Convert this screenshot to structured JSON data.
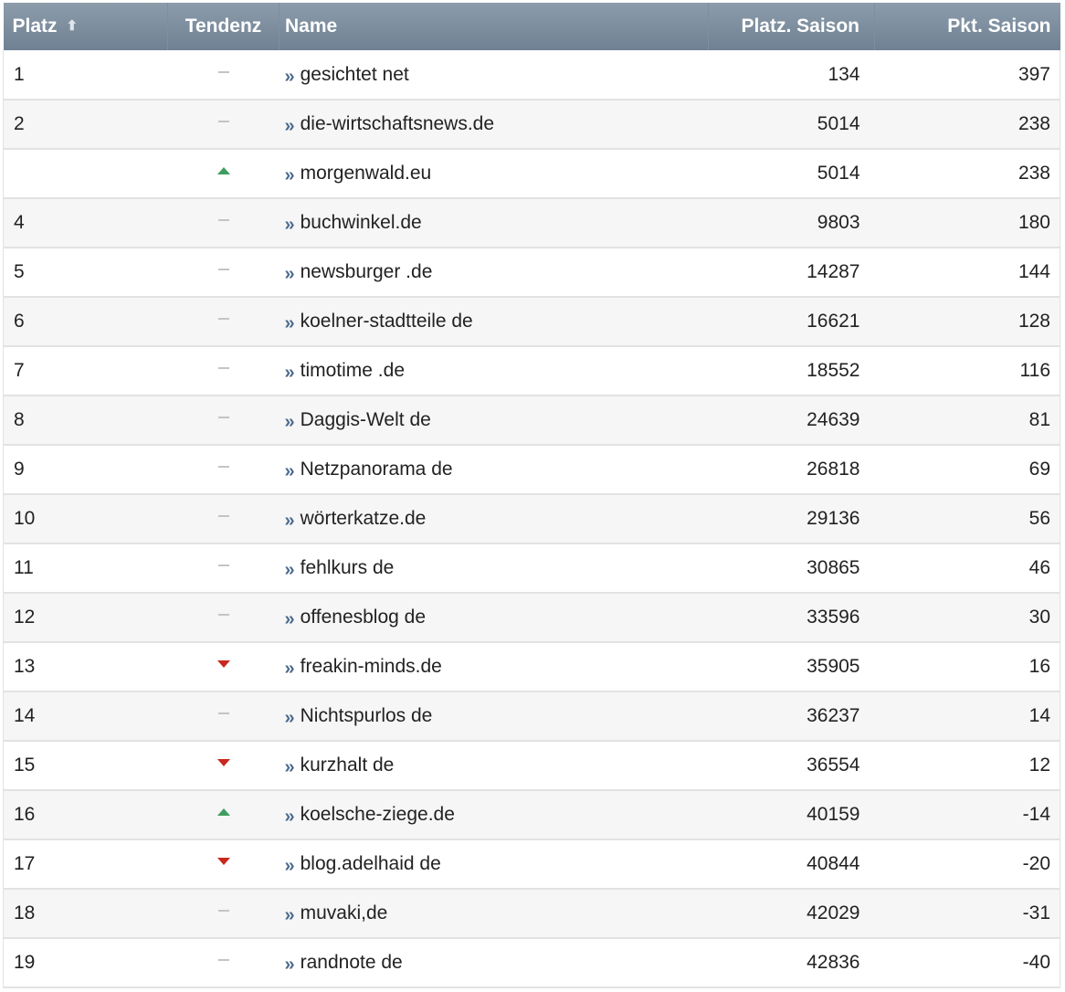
{
  "table": {
    "headers": {
      "platz": "Platz",
      "tendenz": "Tendenz",
      "name": "Name",
      "platz_saison": "Platz. Saison",
      "pkt_saison": "Pkt. Saison"
    },
    "sort_icon": "sort-up-arrow-icon",
    "link_icon": "double-chevron-right-icon",
    "colors": {
      "header": "#7d8ea0",
      "trend_up": "#3f9d5f",
      "trend_down": "#c8281e",
      "trend_same": "#c4c4c4",
      "link_icon": "#4a6a8c"
    },
    "rows": [
      {
        "platz": "1",
        "tendenz": "same",
        "name": "gesichtet net",
        "platz_saison": "134",
        "pkt_saison": "397"
      },
      {
        "platz": "2",
        "tendenz": "same",
        "name": "die-wirtschaftsnews.de",
        "platz_saison": "5014",
        "pkt_saison": "238"
      },
      {
        "platz": "",
        "tendenz": "up",
        "name": "morgenwald.eu",
        "platz_saison": "5014",
        "pkt_saison": "238"
      },
      {
        "platz": "4",
        "tendenz": "same",
        "name": "buchwinkel.de",
        "platz_saison": "9803",
        "pkt_saison": "180"
      },
      {
        "platz": "5",
        "tendenz": "same",
        "name": "newsburger .de",
        "platz_saison": "14287",
        "pkt_saison": "144"
      },
      {
        "platz": "6",
        "tendenz": "same",
        "name": "koelner-stadtteile de",
        "platz_saison": "16621",
        "pkt_saison": "128"
      },
      {
        "platz": "7",
        "tendenz": "same",
        "name": "timotime .de",
        "platz_saison": "18552",
        "pkt_saison": "116"
      },
      {
        "platz": "8",
        "tendenz": "same",
        "name": "Daggis-Welt de",
        "platz_saison": "24639",
        "pkt_saison": "81"
      },
      {
        "platz": "9",
        "tendenz": "same",
        "name": "Netzpanorama de",
        "platz_saison": "26818",
        "pkt_saison": "69"
      },
      {
        "platz": "10",
        "tendenz": "same",
        "name": "wörterkatze.de",
        "platz_saison": "29136",
        "pkt_saison": "56"
      },
      {
        "platz": "11",
        "tendenz": "same",
        "name": "fehlkurs de",
        "platz_saison": "30865",
        "pkt_saison": "46"
      },
      {
        "platz": "12",
        "tendenz": "same",
        "name": "offenesblog de",
        "platz_saison": "33596",
        "pkt_saison": "30"
      },
      {
        "platz": "13",
        "tendenz": "down",
        "name": "freakin-minds.de",
        "platz_saison": "35905",
        "pkt_saison": "16"
      },
      {
        "platz": "14",
        "tendenz": "same",
        "name": "Nichtspurlos de",
        "platz_saison": "36237",
        "pkt_saison": "14"
      },
      {
        "platz": "15",
        "tendenz": "down",
        "name": "kurzhalt de",
        "platz_saison": "36554",
        "pkt_saison": "12"
      },
      {
        "platz": "16",
        "tendenz": "up",
        "name": "koelsche-ziege.de",
        "platz_saison": "40159",
        "pkt_saison": "-14"
      },
      {
        "platz": "17",
        "tendenz": "down",
        "name": "blog.adelhaid de",
        "platz_saison": "40844",
        "pkt_saison": "-20"
      },
      {
        "platz": "18",
        "tendenz": "same",
        "name": "muvaki,de",
        "platz_saison": "42029",
        "pkt_saison": "-31"
      },
      {
        "platz": "19",
        "tendenz": "same",
        "name": "randnote de",
        "platz_saison": "42836",
        "pkt_saison": "-40"
      }
    ]
  }
}
